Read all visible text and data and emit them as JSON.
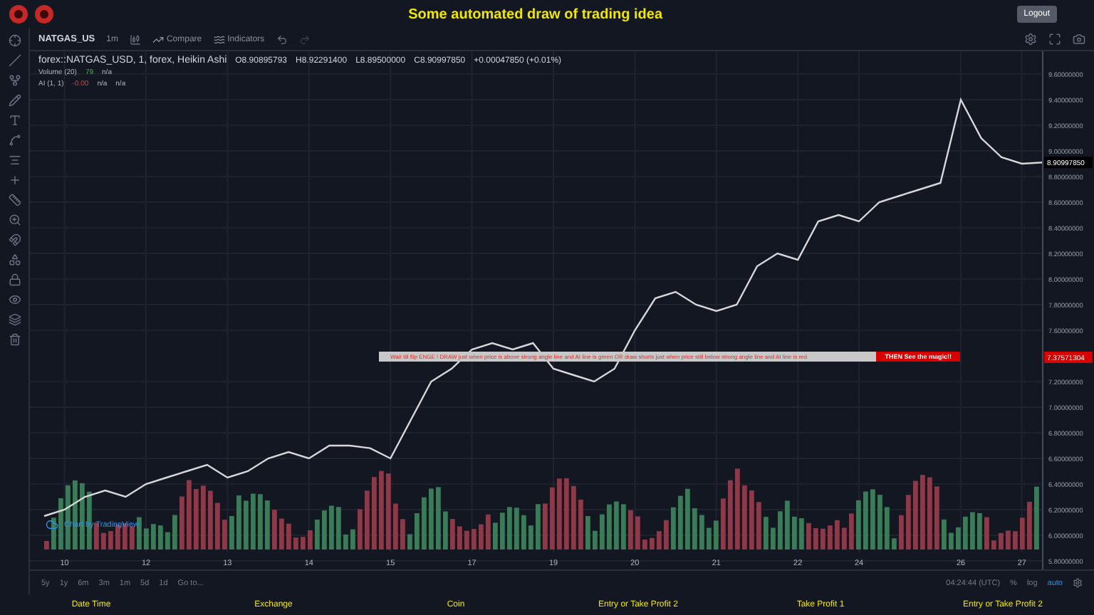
{
  "header": {
    "title": "Some automated draw of trading idea",
    "logout": "Logout"
  },
  "toolbar": {
    "symbol": "NATGAS_US",
    "interval": "1m",
    "compare": "Compare",
    "indicators": "Indicators"
  },
  "legend": {
    "series": "forex::NATGAS_USD, 1, forex, Heikin Ashi",
    "ohlc": [
      "O8.90895793",
      "H8.92291400",
      "L8.89500000",
      "C8.90997850",
      "+0.00047850 (+0.01%)"
    ],
    "studies": [
      {
        "name": "Volume (20)",
        "values": [
          "79",
          "n/a"
        ]
      },
      {
        "name": "AI (1, 1)",
        "values": [
          "-0.00",
          "n/a",
          "n/a"
        ]
      }
    ]
  },
  "chart": {
    "chart_data": {
      "type": "line",
      "categories": [
        null,
        "10",
        null,
        null,
        null,
        "12",
        null,
        null,
        null,
        "13",
        null,
        null,
        null,
        "14",
        null,
        null,
        null,
        "15",
        null,
        null,
        null,
        "17",
        null,
        null,
        null,
        "19",
        null,
        null,
        null,
        "20",
        null,
        null,
        null,
        "21",
        null,
        null,
        null,
        "22",
        null,
        null,
        "24",
        null,
        null,
        null,
        null,
        "26",
        null,
        null,
        "27",
        null
      ],
      "series": [
        {
          "color": "#d8d8d8",
          "values": [
            6.15,
            6.2,
            6.3,
            6.35,
            6.3,
            6.4,
            6.45,
            6.5,
            6.55,
            6.45,
            6.5,
            6.6,
            6.65,
            6.6,
            6.7,
            6.7,
            6.68,
            6.6,
            6.9,
            7.2,
            7.3,
            7.45,
            7.5,
            7.45,
            7.5,
            7.3,
            7.25,
            7.2,
            7.3,
            7.6,
            7.85,
            7.9,
            7.8,
            7.75,
            7.8,
            8.1,
            8.2,
            8.15,
            8.45,
            8.5,
            8.45,
            8.6,
            8.65,
            8.7,
            8.75,
            9.4,
            9.1,
            8.95,
            8.9,
            8.91
          ]
        }
      ],
      "ylim": [
        5.8,
        9.6
      ],
      "grid": true,
      "yticks": [
        {
          "value": 9.6,
          "label": "9.60000000"
        },
        {
          "value": 9.4,
          "label": "9.40000000"
        },
        {
          "value": 9.2,
          "label": "9.20000000"
        },
        {
          "value": 9.0,
          "label": "9.00000000"
        },
        {
          "value": 8.8,
          "label": "8.80000000"
        },
        {
          "value": 8.6,
          "label": "8.60000000"
        },
        {
          "value": 8.4,
          "label": "8.40000000"
        },
        {
          "value": 8.2,
          "label": "8.20000000"
        },
        {
          "value": 8.0,
          "label": "8.00000000"
        },
        {
          "value": 7.8,
          "label": "7.80000000"
        },
        {
          "value": 7.6,
          "label": "7.60000000"
        },
        {
          "value": 7.2,
          "label": "7.20000000"
        },
        {
          "value": 7.0,
          "label": "7.00000000"
        },
        {
          "value": 6.8,
          "label": "6.80000000"
        },
        {
          "value": 6.6,
          "label": "6.60000000"
        },
        {
          "value": 6.4,
          "label": "6.40000000"
        },
        {
          "value": 6.2,
          "label": "6.20000000"
        },
        {
          "value": 6.0,
          "label": "6.00000000"
        },
        {
          "value": 5.8,
          "label": "5.80000000"
        }
      ]
    },
    "current_price": "8.90997850",
    "annotation": {
      "text": "Wait till flip ENGE !   DRAW just when price is above strong angle line and AI line is green      OR      draw shorts just when price still below strong angle line and AI line is red",
      "call_to_action": "THEN See the magic!!",
      "price": "7.37571304"
    },
    "attribution": "Chart by TradingView"
  },
  "range_bar": {
    "ranges": [
      {
        "label": "5y",
        "selected": false
      },
      {
        "label": "1y",
        "selected": false
      },
      {
        "label": "6m",
        "selected": false
      },
      {
        "label": "3m",
        "selected": false
      },
      {
        "label": "1m",
        "selected": false
      },
      {
        "label": "5d",
        "selected": false
      },
      {
        "label": "1d",
        "selected": false
      }
    ],
    "goto": "Go to...",
    "time": "04:24:44 (UTC)",
    "scales": [
      {
        "label": "%",
        "selected": false
      },
      {
        "label": "log",
        "selected": false
      },
      {
        "label": "auto",
        "selected": true
      }
    ]
  },
  "footer": [
    "Date Time",
    "Exchange",
    "Coin",
    "Entry or Take Profit 2",
    "Take Profit 1",
    "Entry or Take Profit 2"
  ]
}
